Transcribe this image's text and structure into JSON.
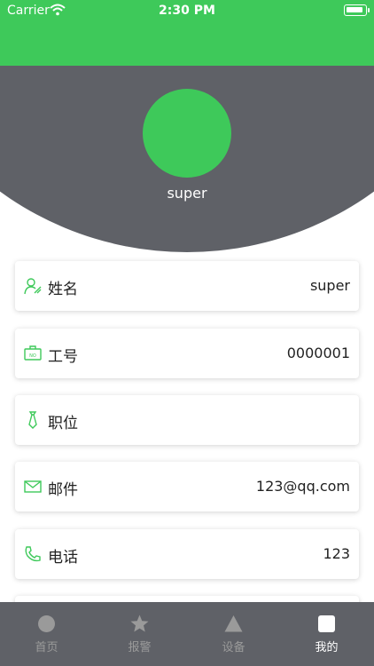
{
  "status_bar": {
    "carrier": "Carrier",
    "time": "2:30 PM"
  },
  "profile": {
    "username": "super"
  },
  "fields": [
    {
      "label": "姓名",
      "value": "super",
      "icon": "person-icon"
    },
    {
      "label": "工号",
      "value": "0000001",
      "icon": "badge-icon"
    },
    {
      "label": "职位",
      "value": "",
      "icon": "tie-icon"
    },
    {
      "label": "邮件",
      "value": "123@qq.com",
      "icon": "mail-icon"
    },
    {
      "label": "电话",
      "value": "123",
      "icon": "phone-icon"
    }
  ],
  "tab_bar": {
    "tabs": [
      {
        "label": "首页",
        "icon": "home-circle-icon",
        "active": false
      },
      {
        "label": "报警",
        "icon": "star-icon",
        "active": false
      },
      {
        "label": "设备",
        "icon": "triangle-icon",
        "active": false
      },
      {
        "label": "我的",
        "icon": "square-icon",
        "active": true
      }
    ]
  },
  "colors": {
    "accent": "#3ec95a",
    "dark": "#5f6167",
    "tab_inactive": "#9a9a9a"
  }
}
